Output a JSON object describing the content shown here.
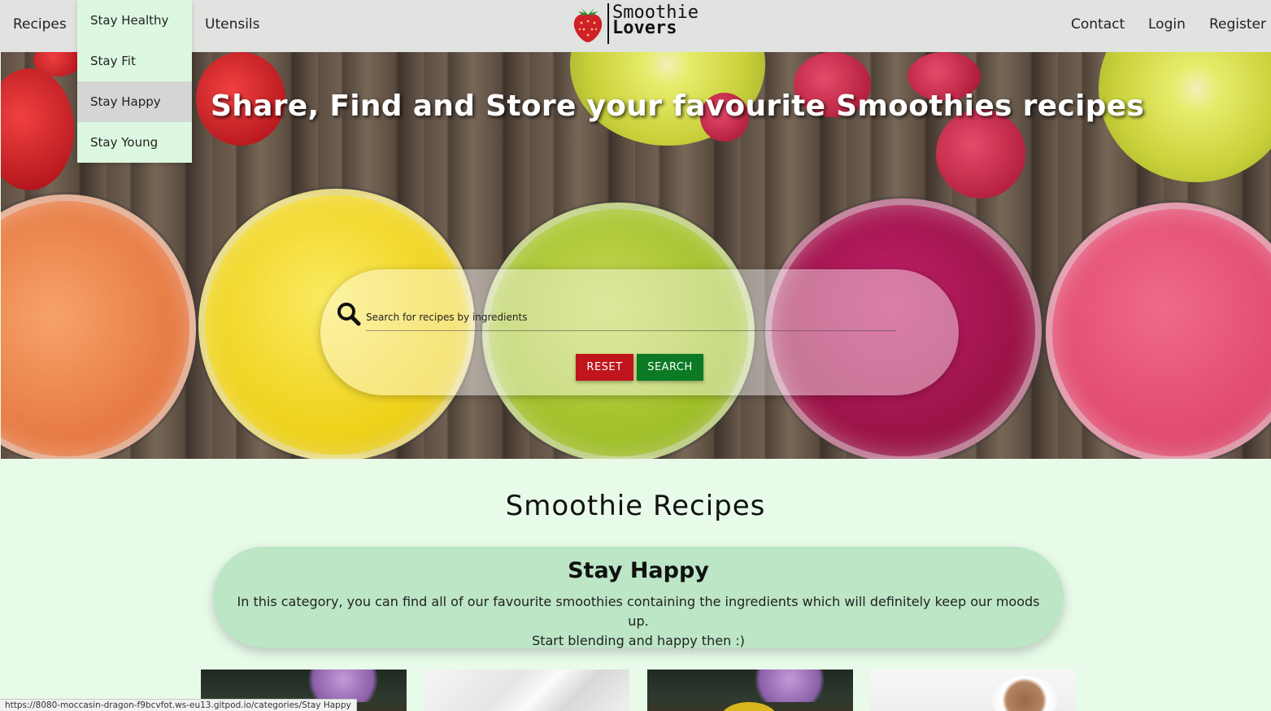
{
  "nav": {
    "recipes": "Recipes",
    "utensils": "Utensils",
    "contact": "Contact",
    "login": "Login",
    "register": "Register",
    "dropdown": [
      "Stay Healthy",
      "Stay Fit",
      "Stay Happy",
      "Stay Young"
    ],
    "dropdown_active": "Stay Happy"
  },
  "logo": {
    "line1": "Smoothie",
    "line2": "Lovers",
    "icon": "strawberry-icon"
  },
  "hero": {
    "title": "Share, Find and Store your favourite Smoothies recipes",
    "search_placeholder": "Search for recipes by ingredients",
    "reset_label": "RESET",
    "search_label": "SEARCH"
  },
  "main": {
    "section_title": "Smoothie Recipes",
    "category": {
      "title": "Stay Happy",
      "description_line1": "In this category, you can find all of our favourite smoothies containing the ingredients which will definitely keep our moods up.",
      "description_line2": "Start blending and happy then :)"
    }
  },
  "status_bar": {
    "url": "https://8080-moccasin-dragon-f9bcvfot.ws-eu13.gitpod.io/categories/Stay Happy"
  },
  "colors": {
    "reset": "#c0151c",
    "search": "#0c7a24",
    "category_bg": "#bce6c6",
    "page_bg": "#e8fbe9",
    "nav_bg": "#e1e3e0"
  }
}
